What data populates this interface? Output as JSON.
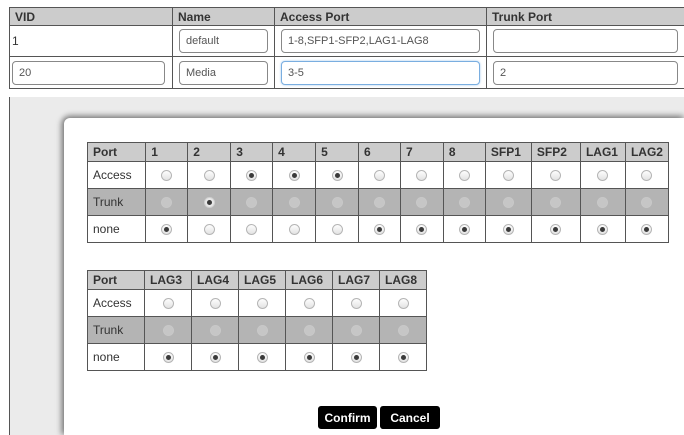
{
  "vlan_table": {
    "headers": [
      "VID",
      "Name",
      "Access Port",
      "Trunk Port"
    ],
    "rows": [
      {
        "vid": "1",
        "name": "default",
        "access": "1-8,SFP1-SFP2,LAG1-LAG8",
        "trunk": ""
      },
      {
        "vid": "20",
        "name": "Media",
        "access": "3-5",
        "trunk": "2"
      }
    ]
  },
  "port_table_1": {
    "corner": "Port",
    "ports": [
      "1",
      "2",
      "3",
      "4",
      "5",
      "6",
      "7",
      "8",
      "SFP1",
      "SFP2",
      "LAG1",
      "LAG2"
    ],
    "row_labels": [
      "Access",
      "Trunk",
      "none"
    ],
    "selection": [
      "none",
      "Trunk",
      "Access",
      "Access",
      "Access",
      "none",
      "none",
      "none",
      "none",
      "none",
      "none",
      "none"
    ]
  },
  "port_table_2": {
    "corner": "Port",
    "ports": [
      "LAG3",
      "LAG4",
      "LAG5",
      "LAG6",
      "LAG7",
      "LAG8"
    ],
    "row_labels": [
      "Access",
      "Trunk",
      "none"
    ],
    "selection": [
      "none",
      "none",
      "none",
      "none",
      "none",
      "none"
    ]
  },
  "buttons": {
    "confirm": "Confirm",
    "cancel": "Cancel"
  },
  "colors": {
    "header_bg": "#cccccc",
    "trunk_row_bg": "#b4b4b4",
    "button_bg": "#000000",
    "focus_border": "#7aaee0"
  }
}
